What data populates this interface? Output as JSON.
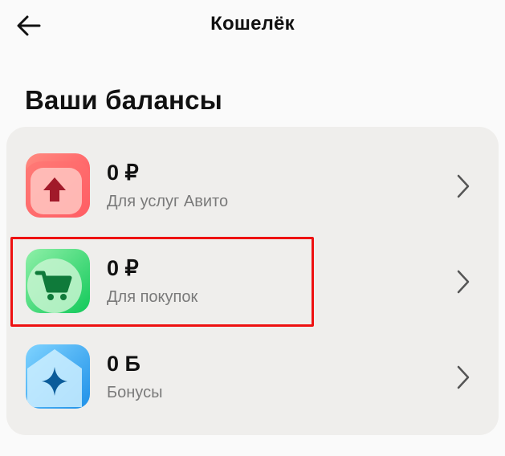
{
  "header": {
    "title": "Кошелёк",
    "back_icon": "arrow-left-icon"
  },
  "section": {
    "title": "Ваши балансы"
  },
  "balances": [
    {
      "amount": "0 ₽",
      "label": "Для услуг Авито",
      "icon": "arrow-up-icon",
      "color": "#ff5a5f"
    },
    {
      "amount": "0 ₽",
      "label": "Для покупок",
      "icon": "shopping-cart-icon",
      "color": "#22c55e"
    },
    {
      "amount": "0 Б",
      "label": "Бонусы",
      "icon": "sparkle-star-icon",
      "color": "#1da1f2"
    }
  ],
  "colors": {
    "background": "#fafafa",
    "card": "#efeeec",
    "secondary_text": "#7a7a7a",
    "highlight": "#ee1111"
  }
}
